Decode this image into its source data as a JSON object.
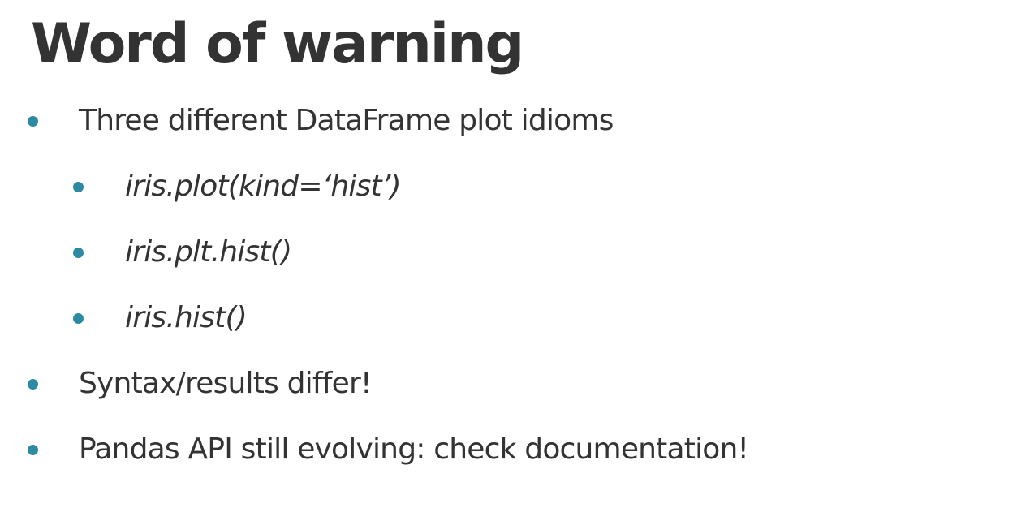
{
  "title": "Word of warning",
  "colors": {
    "bullet": "#2d8aa3",
    "text": "#333333",
    "background": "#ffffff"
  },
  "bullets": [
    {
      "text": "Three different DataFrame plot idioms",
      "level": 1
    },
    {
      "text": "iris.plot(kind=‘hist’)",
      "level": 2
    },
    {
      "text": "iris.plt.hist()",
      "level": 2
    },
    {
      "text": "iris.hist()",
      "level": 2
    },
    {
      "text": "Syntax/results differ!",
      "level": 1
    },
    {
      "text": "Pandas API still evolving: check documentation!",
      "level": 1
    }
  ]
}
